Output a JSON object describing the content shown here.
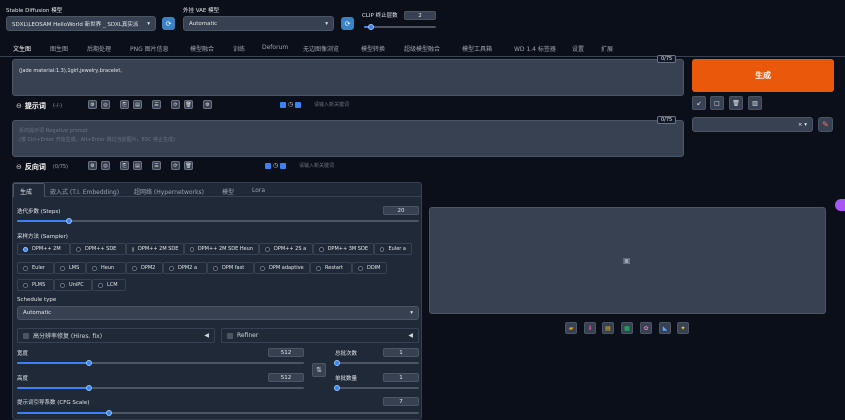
{
  "header": {
    "model_label": "Stable Diffusion 模型",
    "model_value": "SDXL\\LEOSAM HelloWorld 新世界 _ SDXL真实派",
    "vae_label": "外挂 VAE 模型",
    "vae_value": "Automatic",
    "clip_label": "CLIP 终止层数",
    "clip_value": "2"
  },
  "tabs": [
    "文生图",
    "图生图",
    "后期处理",
    "PNG 图片信息",
    "模型融合",
    "训练",
    "Deforum",
    "无边图像浏览",
    "模型转换",
    "超级模型融合",
    "模型工具箱",
    "WD 1.4 标签器",
    "设置",
    "扩展"
  ],
  "prompt": {
    "text": "(Jade material:1.3),1girl,jewelry,bracelet,",
    "count": "0/75",
    "title": "提示词",
    "title_count": "(-/-)",
    "tag_placeholder": "请输入新关键词"
  },
  "negative": {
    "placeholder_line1": "反向提示词 Negative prompt",
    "placeholder_line2": "(按 Ctrl+Enter 开始生成，Alt+Enter 跳过当前图片，ESC 停止生成)",
    "count": "0/75",
    "title": "反向词",
    "title_count": "(0/75)",
    "tag_placeholder": "请输入新关键词"
  },
  "generate": {
    "label": "生成"
  },
  "action_icons": [
    "arrow-icon",
    "trash-icon",
    "clipboard-icon"
  ],
  "subtabs": [
    "生成",
    "嵌入式 (T.I. Embedding)",
    "超网络 (Hypernetworks)",
    "模型",
    "Lora"
  ],
  "steps": {
    "label": "迭代步数 (Steps)",
    "value": "20",
    "fraction": 0.13
  },
  "sampler": {
    "label": "采样方法 (Sampler)",
    "options": [
      "DPM++ 2M",
      "DPM++ SDE",
      "DPM++ 2M SDE",
      "DPM++ 2M SDE Heun",
      "DPM++ 2S a",
      "DPM++ 3M SDE",
      "Euler a",
      "Euler",
      "LMS",
      "Heun",
      "DPM2",
      "DPM2 a",
      "DPM fast",
      "DPM adaptive",
      "Restart",
      "DDIM",
      "PLMS",
      "UniPC",
      "LCM"
    ],
    "selected": "DPM++ 2M"
  },
  "schedule": {
    "label": "Schedule type",
    "value": "Automatic"
  },
  "hires": {
    "label": "高分辨率修复 (Hires. fix)"
  },
  "refiner": {
    "label": "Refiner"
  },
  "width": {
    "label": "宽度",
    "value": "512",
    "fraction": 0.25
  },
  "height": {
    "label": "高度",
    "value": "512",
    "fraction": 0.25
  },
  "batch_count": {
    "label": "总批次数",
    "value": "1",
    "fraction": 0.02
  },
  "batch_size": {
    "label": "单批数量",
    "value": "1",
    "fraction": 0.02
  },
  "cfg": {
    "label": "提示词引导系数 (CFG Scale)",
    "value": "7",
    "fraction": 0.23
  },
  "colors": {
    "generate": "#ea580c",
    "accent": "#3b82f6",
    "bg": "#0b0f19",
    "panel": "#1f2937"
  }
}
